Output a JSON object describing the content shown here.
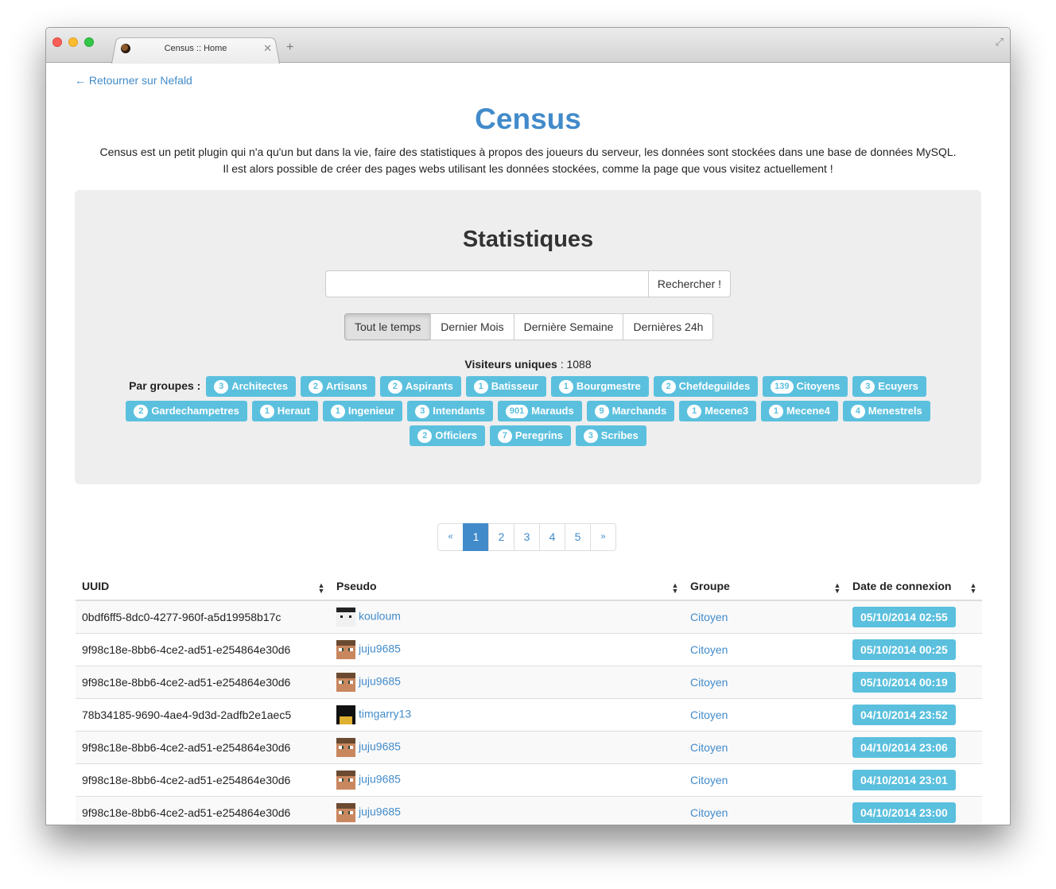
{
  "tab": {
    "title": "Census :: Home",
    "close": "✕",
    "new_tab": "+",
    "fullscreen": "⤢"
  },
  "back_link": "← Retourner sur Nefald",
  "hero": {
    "title": "Census",
    "intro_line1": "Census est un petit plugin qui n'a qu'un but dans la vie, faire des statistiques à propos des joueurs du serveur, les données sont stockées dans une base de données MySQL.",
    "intro_line2": "Il est alors possible de créer des pages webs utilisant les données stockées, comme la page que vous visitez actuellement !"
  },
  "stats": {
    "title": "Statistiques",
    "search_placeholder": "",
    "search_button": "Rechercher !",
    "periods": [
      "Tout le temps",
      "Dernier Mois",
      "Dernière Semaine",
      "Dernières 24h"
    ],
    "active_period": 0,
    "visitors_label": "Visiteurs uniques",
    "visitors_sep": " : ",
    "visitors_value": "1088",
    "groups_label": "Par groupes :",
    "groups": [
      {
        "count": "3",
        "name": "Architectes"
      },
      {
        "count": "2",
        "name": "Artisans"
      },
      {
        "count": "2",
        "name": "Aspirants"
      },
      {
        "count": "1",
        "name": "Batisseur"
      },
      {
        "count": "1",
        "name": "Bourgmestre"
      },
      {
        "count": "2",
        "name": "Chefdeguildes"
      },
      {
        "count": "139",
        "name": "Citoyens"
      },
      {
        "count": "3",
        "name": "Ecuyers"
      },
      {
        "count": "2",
        "name": "Gardechampetres"
      },
      {
        "count": "1",
        "name": "Heraut"
      },
      {
        "count": "1",
        "name": "Ingenieur"
      },
      {
        "count": "3",
        "name": "Intendants"
      },
      {
        "count": "901",
        "name": "Marauds"
      },
      {
        "count": "9",
        "name": "Marchands"
      },
      {
        "count": "1",
        "name": "Mecene3"
      },
      {
        "count": "1",
        "name": "Mecene4"
      },
      {
        "count": "4",
        "name": "Menestrels"
      },
      {
        "count": "2",
        "name": "Officiers"
      },
      {
        "count": "7",
        "name": "Peregrins"
      },
      {
        "count": "3",
        "name": "Scribes"
      }
    ]
  },
  "pagination": {
    "prev": "«",
    "pages": [
      "1",
      "2",
      "3",
      "4",
      "5"
    ],
    "next": "»",
    "active": "1"
  },
  "table": {
    "headers": [
      "UUID",
      "Pseudo",
      "Groupe",
      "Date de connexion"
    ],
    "sort_icon": "▲▼",
    "rows": [
      {
        "uuid": "0bdf6ff5-8dc0-4277-960f-a5d19958b17c",
        "pseudo": "kouloum",
        "avatar": "koulou",
        "group": "Citoyen",
        "date": "05/10/2014 02:55"
      },
      {
        "uuid": "9f98c18e-8bb6-4ce2-ad51-e254864e30d6",
        "pseudo": "juju9685",
        "avatar": "juju",
        "group": "Citoyen",
        "date": "05/10/2014 00:25"
      },
      {
        "uuid": "9f98c18e-8bb6-4ce2-ad51-e254864e30d6",
        "pseudo": "juju9685",
        "avatar": "juju",
        "group": "Citoyen",
        "date": "05/10/2014 00:19"
      },
      {
        "uuid": "78b34185-9690-4ae4-9d3d-2adfb2e1aec5",
        "pseudo": "timgarry13",
        "avatar": "tim",
        "group": "Citoyen",
        "date": "04/10/2014 23:52"
      },
      {
        "uuid": "9f98c18e-8bb6-4ce2-ad51-e254864e30d6",
        "pseudo": "juju9685",
        "avatar": "juju",
        "group": "Citoyen",
        "date": "04/10/2014 23:06"
      },
      {
        "uuid": "9f98c18e-8bb6-4ce2-ad51-e254864e30d6",
        "pseudo": "juju9685",
        "avatar": "juju",
        "group": "Citoyen",
        "date": "04/10/2014 23:01"
      },
      {
        "uuid": "9f98c18e-8bb6-4ce2-ad51-e254864e30d6",
        "pseudo": "juju9685",
        "avatar": "juju",
        "group": "Citoyen",
        "date": "04/10/2014 23:00"
      }
    ]
  }
}
